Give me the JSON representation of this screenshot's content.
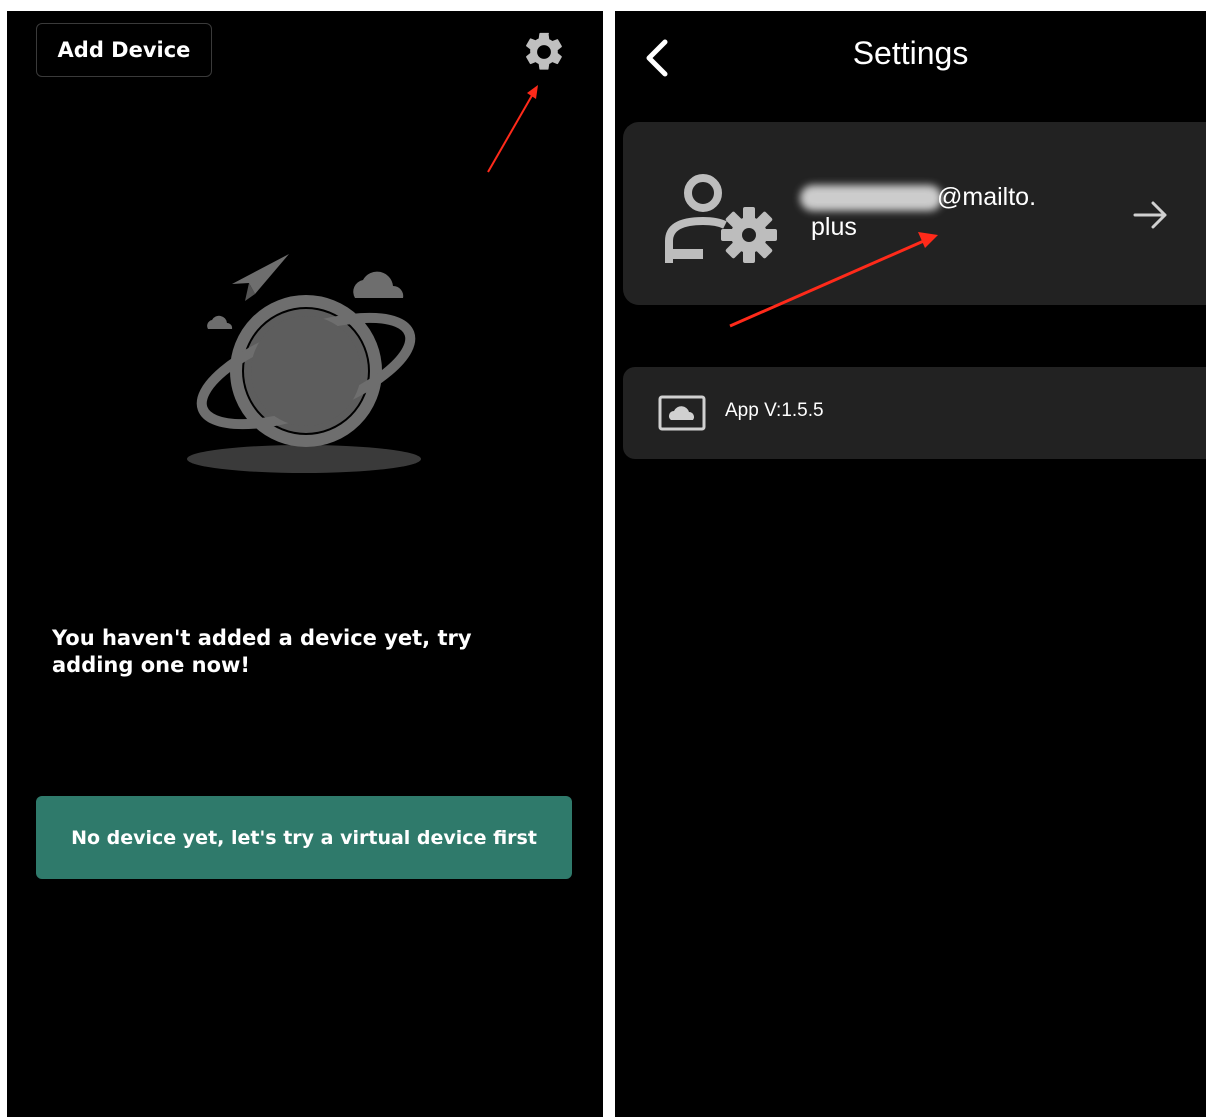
{
  "left_screen": {
    "add_device_label": "Add Device",
    "empty_message": "You haven't added a device yet, try adding one now!",
    "virtual_device_label": "No device yet, let's try a virtual device first",
    "icons": [
      "gear-icon",
      "planet-illustration"
    ]
  },
  "right_screen": {
    "title": "Settings",
    "account": {
      "email_line1": "@mailto.",
      "email_line2": "plus"
    },
    "app_version": "App V:1.5.5",
    "icons": [
      "back-icon",
      "user-settings-icon",
      "arrow-right-icon",
      "cloud-icon"
    ]
  },
  "colors": {
    "background": "#000000",
    "card": "#222222",
    "accent": "#2f7a6b",
    "annotation": "#ff2a1a"
  }
}
